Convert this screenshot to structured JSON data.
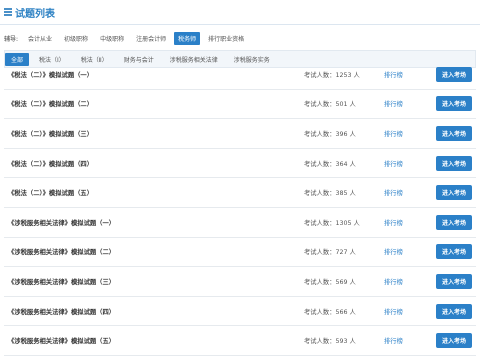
{
  "header": {
    "title": "试题列表"
  },
  "exam_filter": {
    "label": "辅导:",
    "items": [
      "会计从业",
      "初级职称",
      "中级职称",
      "注册会计师",
      "税务师",
      "排行职业资格"
    ],
    "active": 4
  },
  "subject_filter": {
    "items": [
      "全部",
      "税法（Ⅰ）",
      "税法（Ⅱ）",
      "财务与会计",
      "涉税服务相关法律",
      "涉税服务实务"
    ],
    "active": 0
  },
  "columns": {
    "count_prefix": "考试人数：",
    "rank_label": "排行榜",
    "enter_label": "进入考场"
  },
  "papers": [
    {
      "name": "《税法（二）》模拟试题（一）",
      "count": "1253 人"
    },
    {
      "name": "《税法（二）》模拟试题（二）",
      "count": "501 人"
    },
    {
      "name": "《税法（二）》模拟试题（三）",
      "count": "396 人"
    },
    {
      "name": "《税法（二）》模拟试题（四）",
      "count": "364 人"
    },
    {
      "name": "《税法（二）》模拟试题（五）",
      "count": "385 人"
    },
    {
      "name": "《涉税服务相关法律》模拟试题（一）",
      "count": "1305 人"
    },
    {
      "name": "《涉税服务相关法律》模拟试题（二）",
      "count": "727 人"
    },
    {
      "name": "《涉税服务相关法律》模拟试题（三）",
      "count": "569 人"
    },
    {
      "name": "《涉税服务相关法律》模拟试题（四）",
      "count": "566 人"
    },
    {
      "name": "《涉税服务相关法律》模拟试题（五）",
      "count": "593 人"
    }
  ]
}
